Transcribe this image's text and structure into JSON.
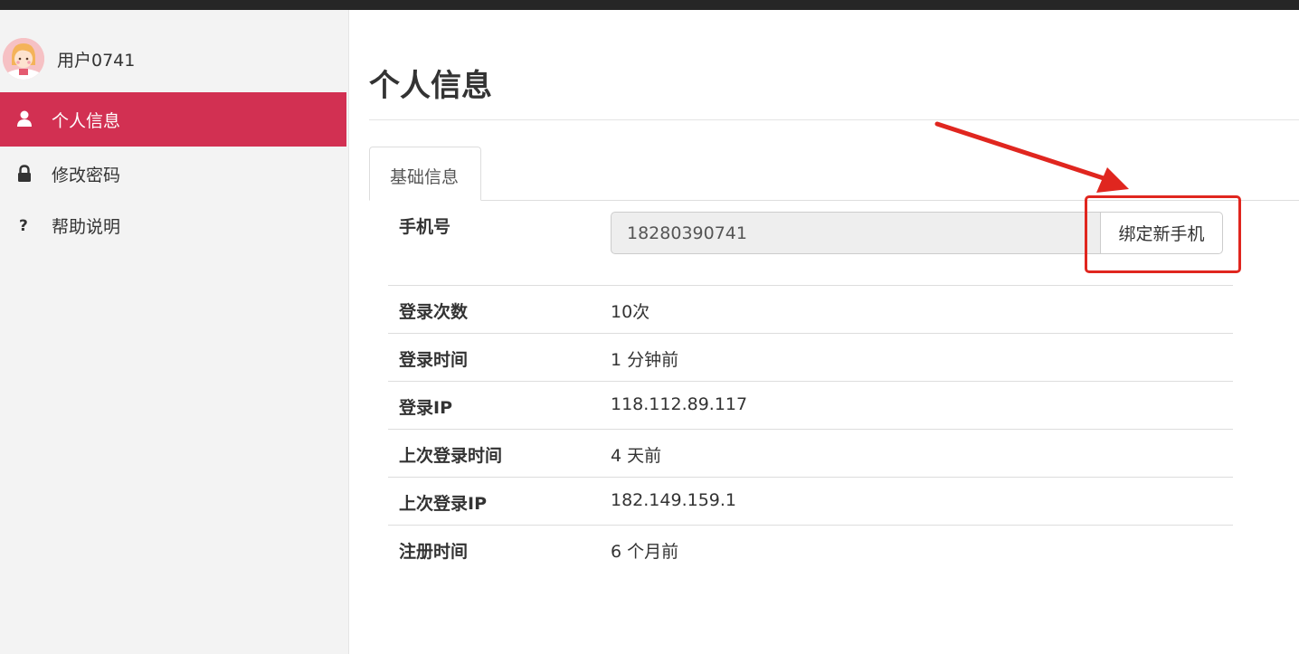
{
  "user": {
    "name": "用户0741"
  },
  "sidebar": {
    "items": [
      {
        "label": "个人信息",
        "icon": "user-icon",
        "active": true
      },
      {
        "label": "修改密码",
        "icon": "lock-icon",
        "active": false
      },
      {
        "label": "帮助说明",
        "icon": "question-icon",
        "active": false
      }
    ]
  },
  "main": {
    "title": "个人信息",
    "tabs": [
      {
        "label": "基础信息",
        "active": true
      }
    ],
    "phone": {
      "label": "手机号",
      "value": "18280390741",
      "bind_button": "绑定新手机"
    },
    "info": [
      {
        "key": "登录次数",
        "value": "10次"
      },
      {
        "key": "登录时间",
        "value": "1 分钟前"
      },
      {
        "key": "登录IP",
        "value": "118.112.89.117"
      },
      {
        "key": "上次登录时间",
        "value": "4 天前"
      },
      {
        "key": "上次登录IP",
        "value": "182.149.159.1"
      },
      {
        "key": "注册时间",
        "value": "6 个月前"
      }
    ]
  },
  "colors": {
    "accent": "#d23052",
    "annotation": "#e0261f",
    "sidebar_bg": "#f3f3f3",
    "topbar": "#262626"
  }
}
